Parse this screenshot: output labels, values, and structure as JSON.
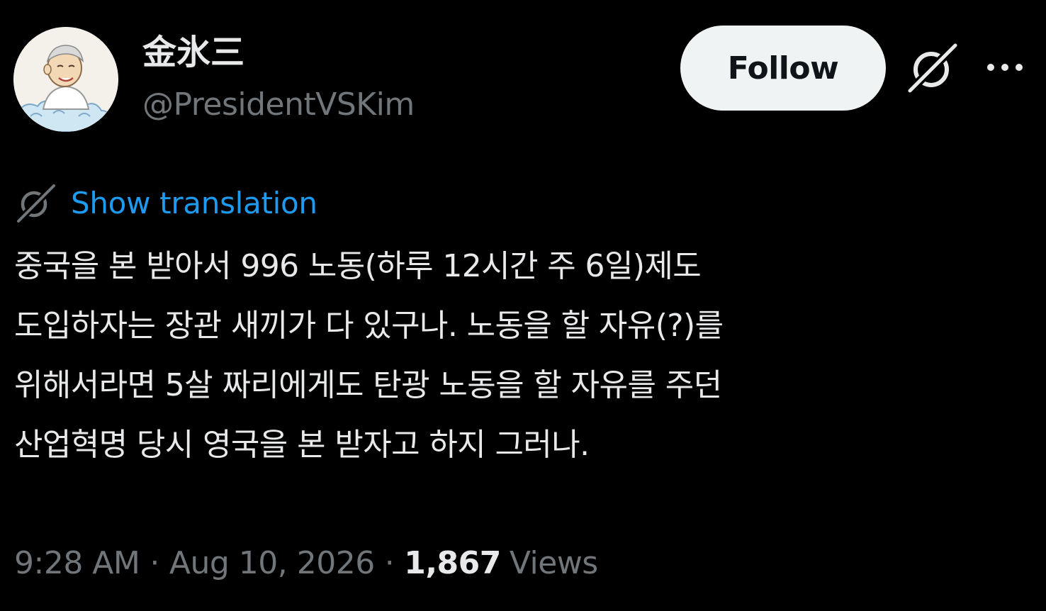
{
  "author": {
    "display_name": "金氷三",
    "handle": "@PresidentVSKim",
    "avatar_icon": "cartoon-portrait-avatar"
  },
  "actions": {
    "follow_label": "Follow",
    "grok_icon": "grok-icon",
    "more_icon": "more-icon"
  },
  "translation": {
    "icon": "translate-icon",
    "label": "Show translation"
  },
  "tweet": {
    "lines": [
      "중국을 본 받아서 996 노동(하루 12시간 주 6일)제도",
      "도입하자는 장관 새끼가 다 있구나. 노동을 할 자유(?)를",
      "위해서라면 5살 짜리에게도 탄광 노동을 할 자유를 주던",
      "산업혁명 당시 영국을 본 받자고 하지 그러나."
    ]
  },
  "meta": {
    "time": "9:28 AM",
    "separator": "·",
    "date": "Aug 10, 2026",
    "views_count": "1,867",
    "views_label": "Views"
  },
  "colors": {
    "background": "#000000",
    "primary_text": "#e7e9ea",
    "secondary_text": "#71767b",
    "link": "#1d9bf0",
    "follow_button_bg": "#eff3f4",
    "follow_button_text": "#0f1419"
  }
}
